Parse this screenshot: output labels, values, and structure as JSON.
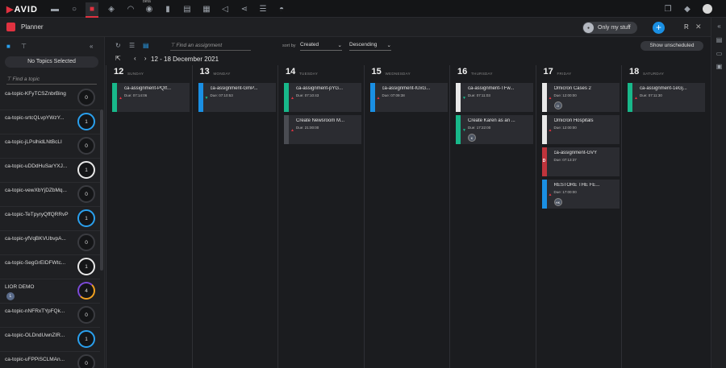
{
  "brand": {
    "logo_text": "AVID",
    "accent": "#e03240"
  },
  "topnav": {
    "icons": [
      "folder-icon",
      "search-icon",
      "planner-icon",
      "eye-icon",
      "headset-icon",
      "broadcast-icon",
      "bookmark-icon",
      "news-icon",
      "gallery-icon",
      "share-icon",
      "rundown-icon",
      "cam-icon"
    ],
    "beta_label": "beta",
    "right_icons": [
      "copy-icon",
      "bell-icon",
      "user-icon"
    ]
  },
  "appbar": {
    "title": "Planner",
    "only_my_stuff": "Only my stuff",
    "add_label": "+",
    "pin_label": "R",
    "close_label": "✕"
  },
  "sidebar": {
    "no_topics": "No Topics Selected",
    "find_placeholder": "Find a topic",
    "topics": [
      {
        "name": "ca-topic-KFyTCSZnbrBing",
        "count": "0",
        "ring": "gray"
      },
      {
        "name": "ca-topic-srtcQLvpYWzY...",
        "count": "1",
        "ring": "blue"
      },
      {
        "name": "ca-topic-jLPslhidLNtBcLI",
        "count": "0",
        "ring": "gray"
      },
      {
        "name": "ca-topic-uDDdHuSarYXJ...",
        "count": "1",
        "ring": "white"
      },
      {
        "name": "ca-topic-vewXbYjDZbMq...",
        "count": "0",
        "ring": "gray"
      },
      {
        "name": "ca-topic-TeTpyryQffQRRvP",
        "count": "1",
        "ring": "blue"
      },
      {
        "name": "ca-topic-yfVqBKVUbvpA...",
        "count": "0",
        "ring": "gray"
      },
      {
        "name": "ca-topic-SegGrEIDFWtc...",
        "count": "1",
        "ring": "white"
      },
      {
        "name": "LIOR DEMO",
        "count": "4",
        "ring": "multi",
        "badge": "L"
      },
      {
        "name": "ca-topic-nNFRxTYpFQk...",
        "count": "0",
        "ring": "gray"
      },
      {
        "name": "ca-topic-OLDndUwnZIR...",
        "count": "1",
        "ring": "blue"
      },
      {
        "name": "ca-topic-uFPPiSCLMAn...",
        "count": "0",
        "ring": "gray"
      }
    ]
  },
  "toolbar": {
    "search_placeholder": "Find an assignment",
    "sort_by_label": "sort by",
    "sort_field": "Created",
    "sort_order": "Descending",
    "show_unscheduled": "Show unscheduled",
    "date_range": "12 - 18 December 2021"
  },
  "days": [
    {
      "num": "12",
      "name": "SUNDAY",
      "cards": [
        {
          "title": "ca-assignment-PQIf...",
          "due": "Due: 07:14:06",
          "stripe": "#18b88a",
          "prio": "up"
        }
      ]
    },
    {
      "num": "13",
      "name": "MONDAY",
      "cards": [
        {
          "title": "ca-assignment-GmP...",
          "due": "Due: 07:10:53",
          "stripe": "#1a8fe3",
          "prio": "down"
        }
      ]
    },
    {
      "num": "14",
      "name": "TUESDAY",
      "cards": [
        {
          "title": "ca-assignment-pYG...",
          "due": "Due: 07:10:43",
          "stripe": "#18b88a",
          "prio": "up"
        },
        {
          "title": "Create Newsroom M...",
          "due": "Due: 21:00:00",
          "stripe": "#4a4c52",
          "prio": "up"
        }
      ]
    },
    {
      "num": "15",
      "name": "WEDNESDAY",
      "cards": [
        {
          "title": "ca-assignment-IUxG...",
          "due": "Due: 07:09:38",
          "stripe": "#1a8fe3",
          "prio": "up"
        }
      ]
    },
    {
      "num": "16",
      "name": "THURSDAY",
      "cards": [
        {
          "title": "ca-assignment-TFw...",
          "due": "Due: 07:11:03",
          "stripe": "#e8e8e8",
          "prio": "down"
        },
        {
          "title": "Create Karen as an ...",
          "due": "Due: 17:22:00",
          "stripe": "#18b88a",
          "prio": "down",
          "badge": "K"
        }
      ]
    },
    {
      "num": "17",
      "name": "FRIDAY",
      "cards": [
        {
          "title": "Omicron Cases 2",
          "due": "Due: 12:00:00",
          "stripe": "#e8e8e8",
          "prio": "up",
          "badge": "O"
        },
        {
          "title": "Omicron Hospitals",
          "due": "Due: 12:00:00",
          "stripe": "#e8e8e8",
          "prio": "up"
        },
        {
          "title": "ca-assignment-GVY",
          "due": "Due: 07:13:37",
          "stripe": "#c0343c",
          "prio": "",
          "stripe_label": "D"
        },
        {
          "title": "RESTORE THE FE...",
          "due": "Due: 17:00:00",
          "stripe": "#1a8fe3",
          "prio": "up",
          "badge": "HK"
        }
      ]
    },
    {
      "num": "18",
      "name": "SATURDAY",
      "cards": [
        {
          "title": "ca-assignment-1eGj...",
          "due": "Due: 07:11:30",
          "stripe": "#18b88a",
          "prio": "up"
        }
      ]
    }
  ],
  "rightbar": {
    "icons": [
      "collapse-icon",
      "panel-icon",
      "media-icon",
      "chat-icon"
    ]
  }
}
